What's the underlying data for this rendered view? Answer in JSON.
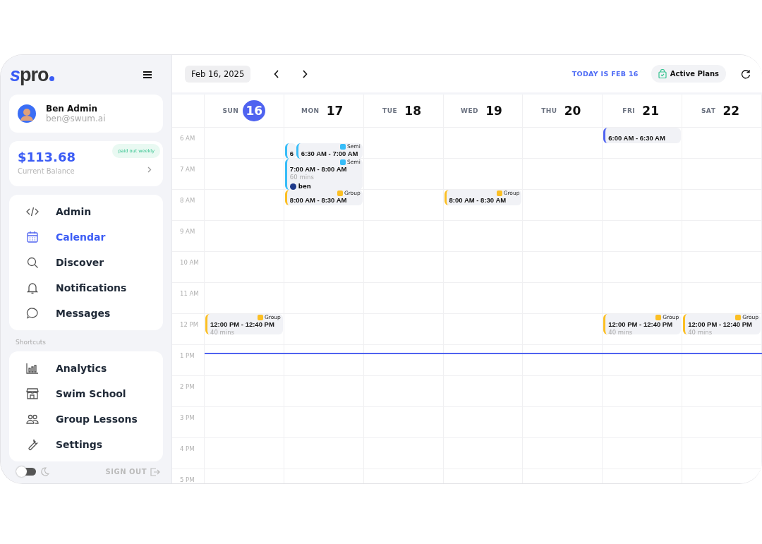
{
  "sidebar": {
    "logo": "spro",
    "user": {
      "name": "Ben Admin",
      "email": "ben@swum.ai"
    },
    "balance": {
      "amount": "$113.68",
      "label": "Current Balance",
      "badge": "paid out weekly"
    },
    "nav": [
      {
        "label": "Admin",
        "selected": false
      },
      {
        "label": "Calendar",
        "selected": true
      },
      {
        "label": "Discover",
        "selected": false
      },
      {
        "label": "Notifications",
        "selected": false
      },
      {
        "label": "Messages",
        "selected": false
      }
    ],
    "shortcuts_title": "Shortcuts",
    "shortcuts": [
      {
        "label": "Analytics"
      },
      {
        "label": "Swim School"
      },
      {
        "label": "Group Lessons"
      },
      {
        "label": "Settings"
      }
    ],
    "dark_mode": false,
    "sign_out": "SIGN OUT"
  },
  "toolbar": {
    "date": "Feb 16, 2025",
    "today": "TODAY IS FEB 16",
    "active_plans": "Active Plans"
  },
  "calendar": {
    "hours": [
      "6 AM",
      "7 AM",
      "8 AM",
      "9 AM",
      "10 AM",
      "11 AM",
      "12 PM",
      "1 PM",
      "2 PM",
      "3 PM",
      "4 PM",
      "5 PM"
    ],
    "days": [
      {
        "weekday": "SUN",
        "date": "16",
        "selected": true,
        "events": [
          {
            "kind": "full",
            "time": "12:00 PM - 12:40 PM",
            "duration": "40 mins",
            "tag": "Group",
            "color": "#fbbf24"
          }
        ]
      },
      {
        "weekday": "MON",
        "date": "17",
        "selected": false,
        "events": [
          {
            "kind": "overlapped",
            "time": "6",
            "color": "#38bdf8"
          },
          {
            "kind": "full",
            "time": "6:30 AM - 7:00 AM",
            "tag": "Semi",
            "color": "#38bdf8"
          },
          {
            "kind": "full",
            "time": "7:00 AM - 8:00 AM",
            "duration": "60 mins",
            "attendee": "ben",
            "tag": "Semi",
            "color": "#38bdf8"
          },
          {
            "kind": "full",
            "time": "8:00 AM - 8:30 AM",
            "tag": "Group",
            "color": "#fbbf24"
          }
        ]
      },
      {
        "weekday": "TUE",
        "date": "18",
        "selected": false
      },
      {
        "weekday": "WED",
        "date": "19",
        "selected": false,
        "events": [
          {
            "kind": "full",
            "time": "8:00 AM - 8:30 AM",
            "tag": "Group",
            "color": "#fbbf24"
          }
        ]
      },
      {
        "weekday": "THU",
        "date": "20",
        "selected": false
      },
      {
        "weekday": "FRI",
        "date": "21",
        "selected": false,
        "events": [
          {
            "kind": "full",
            "time": "6:00 AM - 6:30 AM",
            "color": "#4f63f0"
          },
          {
            "kind": "full",
            "time": "12:00 PM - 12:40 PM",
            "duration": "40 mins",
            "tag": "Group",
            "color": "#fbbf24"
          }
        ]
      },
      {
        "weekday": "SAT",
        "date": "22",
        "selected": false,
        "events": [
          {
            "kind": "full",
            "time": "12:00 PM - 12:40 PM",
            "duration": "40 mins",
            "tag": "Group",
            "color": "#fbbf24"
          }
        ]
      }
    ]
  }
}
